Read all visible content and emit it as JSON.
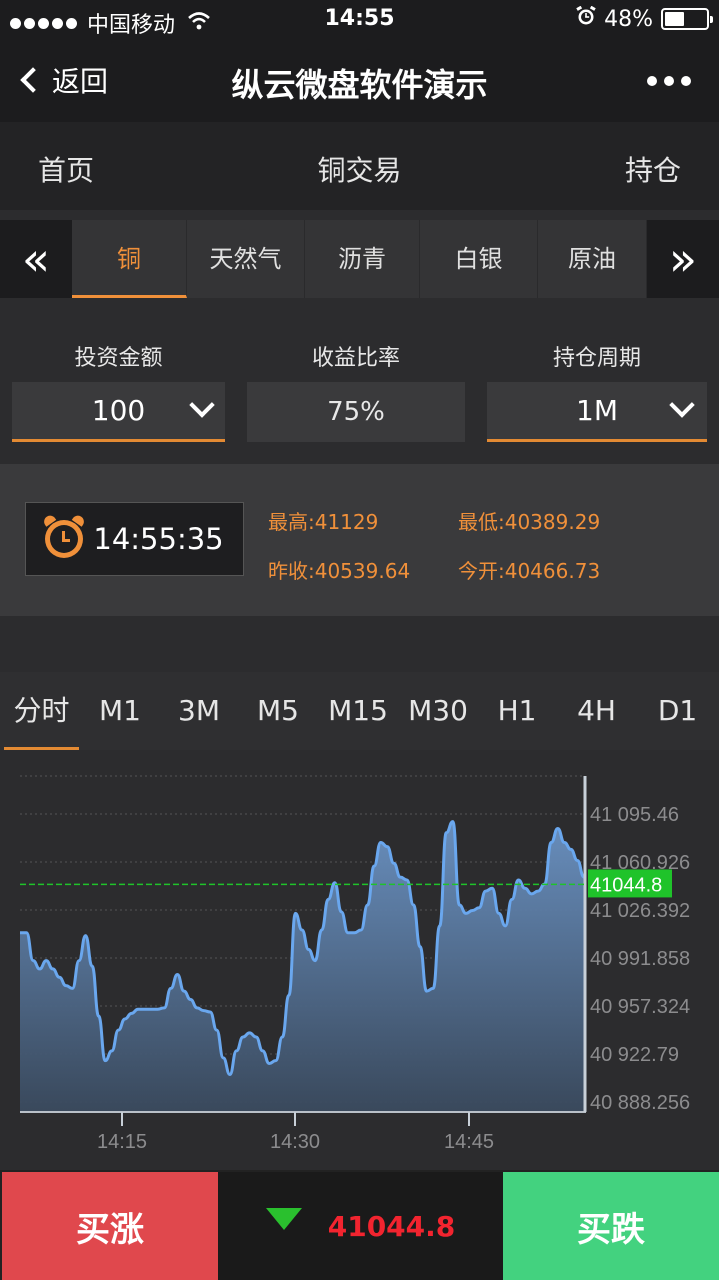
{
  "status_bar": {
    "carrier": "中国移动",
    "time": "14:55",
    "battery": "48%",
    "battery_level": 0.48
  },
  "nav": {
    "back_label": "返回",
    "title": "纵云微盘软件演示"
  },
  "top_tabs": [
    "首页",
    "铜交易",
    "持仓"
  ],
  "commodity_tabs": {
    "items": [
      "铜",
      "天然气",
      "沥青",
      "白银",
      "原油"
    ],
    "active_index": 0
  },
  "form": {
    "invest_label": "投资金额",
    "invest_value": "100",
    "rate_label": "收益比率",
    "rate_value": "75%",
    "period_label": "持仓周期",
    "period_value": "1M"
  },
  "info": {
    "clock": "14:55:35",
    "high": "最高:41129",
    "low": "最低:40389.29",
    "prev_close": "昨收:40539.64",
    "open": "今开:40466.73"
  },
  "timeframes": {
    "items": [
      "分时",
      "M1",
      "3M",
      "M5",
      "M15",
      "M30",
      "H1",
      "4H",
      "D1"
    ],
    "active_index": 0
  },
  "chart_data": {
    "type": "area",
    "y_ticks": [
      "41 095.46",
      "41 060.926",
      "41 026.392",
      "40 991.858",
      "40 957.324",
      "40 922.79",
      "40 888.256"
    ],
    "ylim": [
      40888.256,
      41095.46
    ],
    "x_ticks": [
      "14:15",
      "14:30",
      "14:45"
    ],
    "current_price": 41044.8,
    "current_label": "41044.8",
    "values": [
      41010,
      41010,
      40990,
      40984,
      40990,
      40984,
      40978,
      40972,
      40970,
      40990,
      41008,
      40986,
      40950,
      40918,
      40925,
      40940,
      40948,
      40952,
      40955,
      40955,
      40955,
      40955,
      40956,
      40970,
      40980,
      40968,
      40962,
      40956,
      40954,
      40953,
      40940,
      40920,
      40908,
      40925,
      40935,
      40938,
      40935,
      40925,
      40916,
      40918,
      40935,
      40965,
      41024,
      41012,
      40998,
      40990,
      41012,
      41034,
      41046,
      41025,
      41010,
      41010,
      41012,
      41030,
      41058,
      41075,
      41072,
      41060,
      41050,
      41048,
      41030,
      41000,
      40968,
      40970,
      41015,
      41082,
      41090,
      41030,
      41024,
      41026,
      41028,
      41040,
      41042,
      41024,
      41015,
      41034,
      41048,
      41042,
      41038,
      41040,
      41045,
      41075,
      41085,
      41075,
      41070,
      41062,
      41050
    ],
    "grid": true
  },
  "bottom": {
    "buy_up": "买涨",
    "buy_down": "买跌",
    "price": "41044.8"
  },
  "colors": {
    "accent": "#e38a33",
    "up": "#e0484d",
    "down": "#43d27f",
    "line": "#6aa7ee",
    "current": "#1fc32a"
  }
}
